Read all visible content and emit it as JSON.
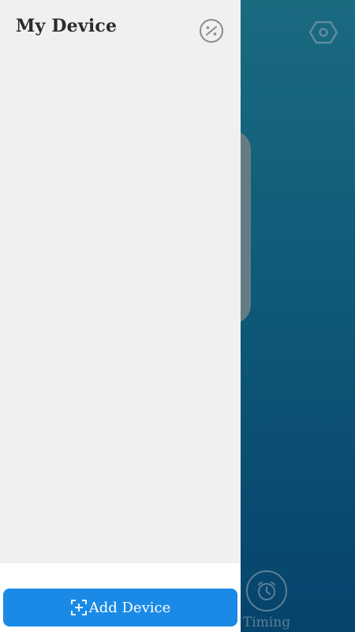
{
  "drawer": {
    "title": "My Device",
    "add_device_label": "Add Device"
  },
  "main": {
    "timing_label": "Timing"
  },
  "icons": {
    "discount": "percent-circle-icon",
    "settings": "hexagon-settings-icon",
    "timing": "alarm-clock-icon",
    "add": "scan-plus-icon"
  },
  "colors": {
    "drawer_bg": "#f0f0f1",
    "accent": "#1a8ae6",
    "main_bg_top": "#1a6a80",
    "main_bg_bottom": "#06436c"
  }
}
